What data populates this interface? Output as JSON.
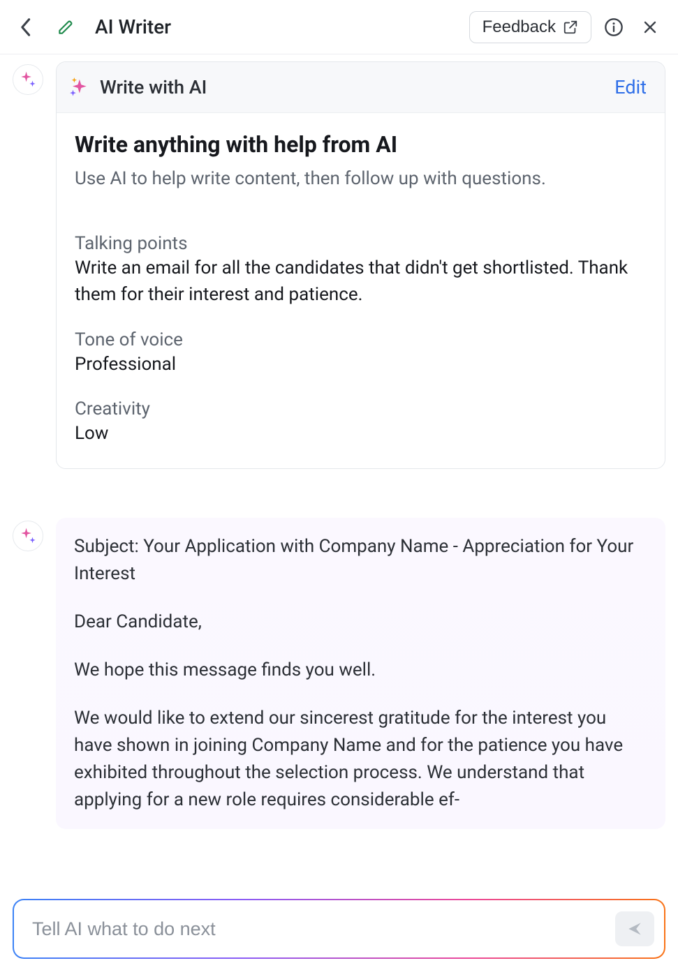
{
  "header": {
    "title": "AI Writer",
    "feedback_label": "Feedback"
  },
  "prompt_card": {
    "header_label": "Write with AI",
    "edit_label": "Edit",
    "heading": "Write anything with help from AI",
    "subheading": "Use AI to help write content, then follow up with questions.",
    "talking_points_label": "Talking points",
    "talking_points_value": "Write an email for all the candidates that didn't get shortlisted. Thank them for their interest and patience.",
    "tone_label": "Tone of voice",
    "tone_value": "Professional",
    "creativity_label": "Creativity",
    "creativity_value": "Low"
  },
  "ai_output": {
    "subject": "Subject: Your Application with Company Name - Appreciation for Your Interest",
    "salutation": "Dear Candidate,",
    "line1": "We hope this message finds you well.",
    "line2": "We would like to extend our sincerest gratitude for the interest you have shown in joining Company Name and for the patience you have exhibited throughout the selection process. We understand that applying for a new role requires considerable ef-"
  },
  "footer": {
    "placeholder": "Tell AI what to do next"
  }
}
